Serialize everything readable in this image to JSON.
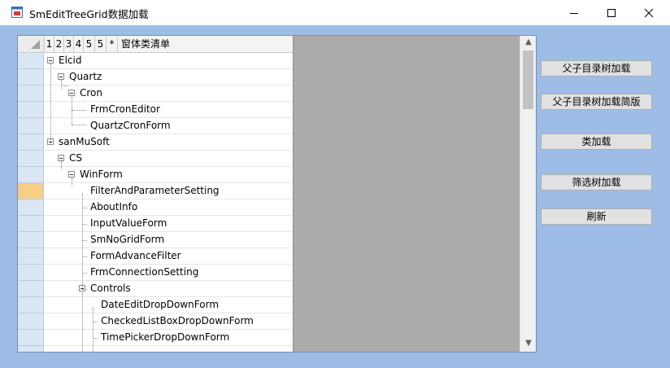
{
  "window": {
    "title": "SmEditTreeGrid数据加载"
  },
  "grid": {
    "columns": [
      "1",
      "2",
      "3",
      "4",
      "5",
      "5",
      "*",
      "窗体类清单"
    ],
    "rows": [
      {
        "label": "Elcid"
      },
      {
        "label": "Quartz"
      },
      {
        "label": "Cron"
      },
      {
        "label": "FrmCronEditor"
      },
      {
        "label": "QuartzCronForm"
      },
      {
        "label": "sanMuSoft"
      },
      {
        "label": "CS"
      },
      {
        "label": "WinForm"
      },
      {
        "label": "FilterAndParameterSetting"
      },
      {
        "label": "AboutInfo"
      },
      {
        "label": "InputValueForm"
      },
      {
        "label": "SmNoGridForm"
      },
      {
        "label": "FormAdvanceFilter"
      },
      {
        "label": "FrmConnectionSetting"
      },
      {
        "label": "Controls"
      },
      {
        "label": "DateEditDropDownForm"
      },
      {
        "label": "CheckedListBoxDropDownForm"
      },
      {
        "label": "TimePickerDropDownForm"
      }
    ]
  },
  "buttons": {
    "parent_tree": "父子目录树加载",
    "parent_tree_simple": "父子目录树加载简版",
    "class_load": "类加载",
    "filter_tree": "筛选树加载",
    "refresh": "刷新"
  },
  "icons": {
    "minimize": "minimize-icon",
    "maximize": "maximize-icon",
    "close": "close-icon",
    "app": "app-icon"
  }
}
